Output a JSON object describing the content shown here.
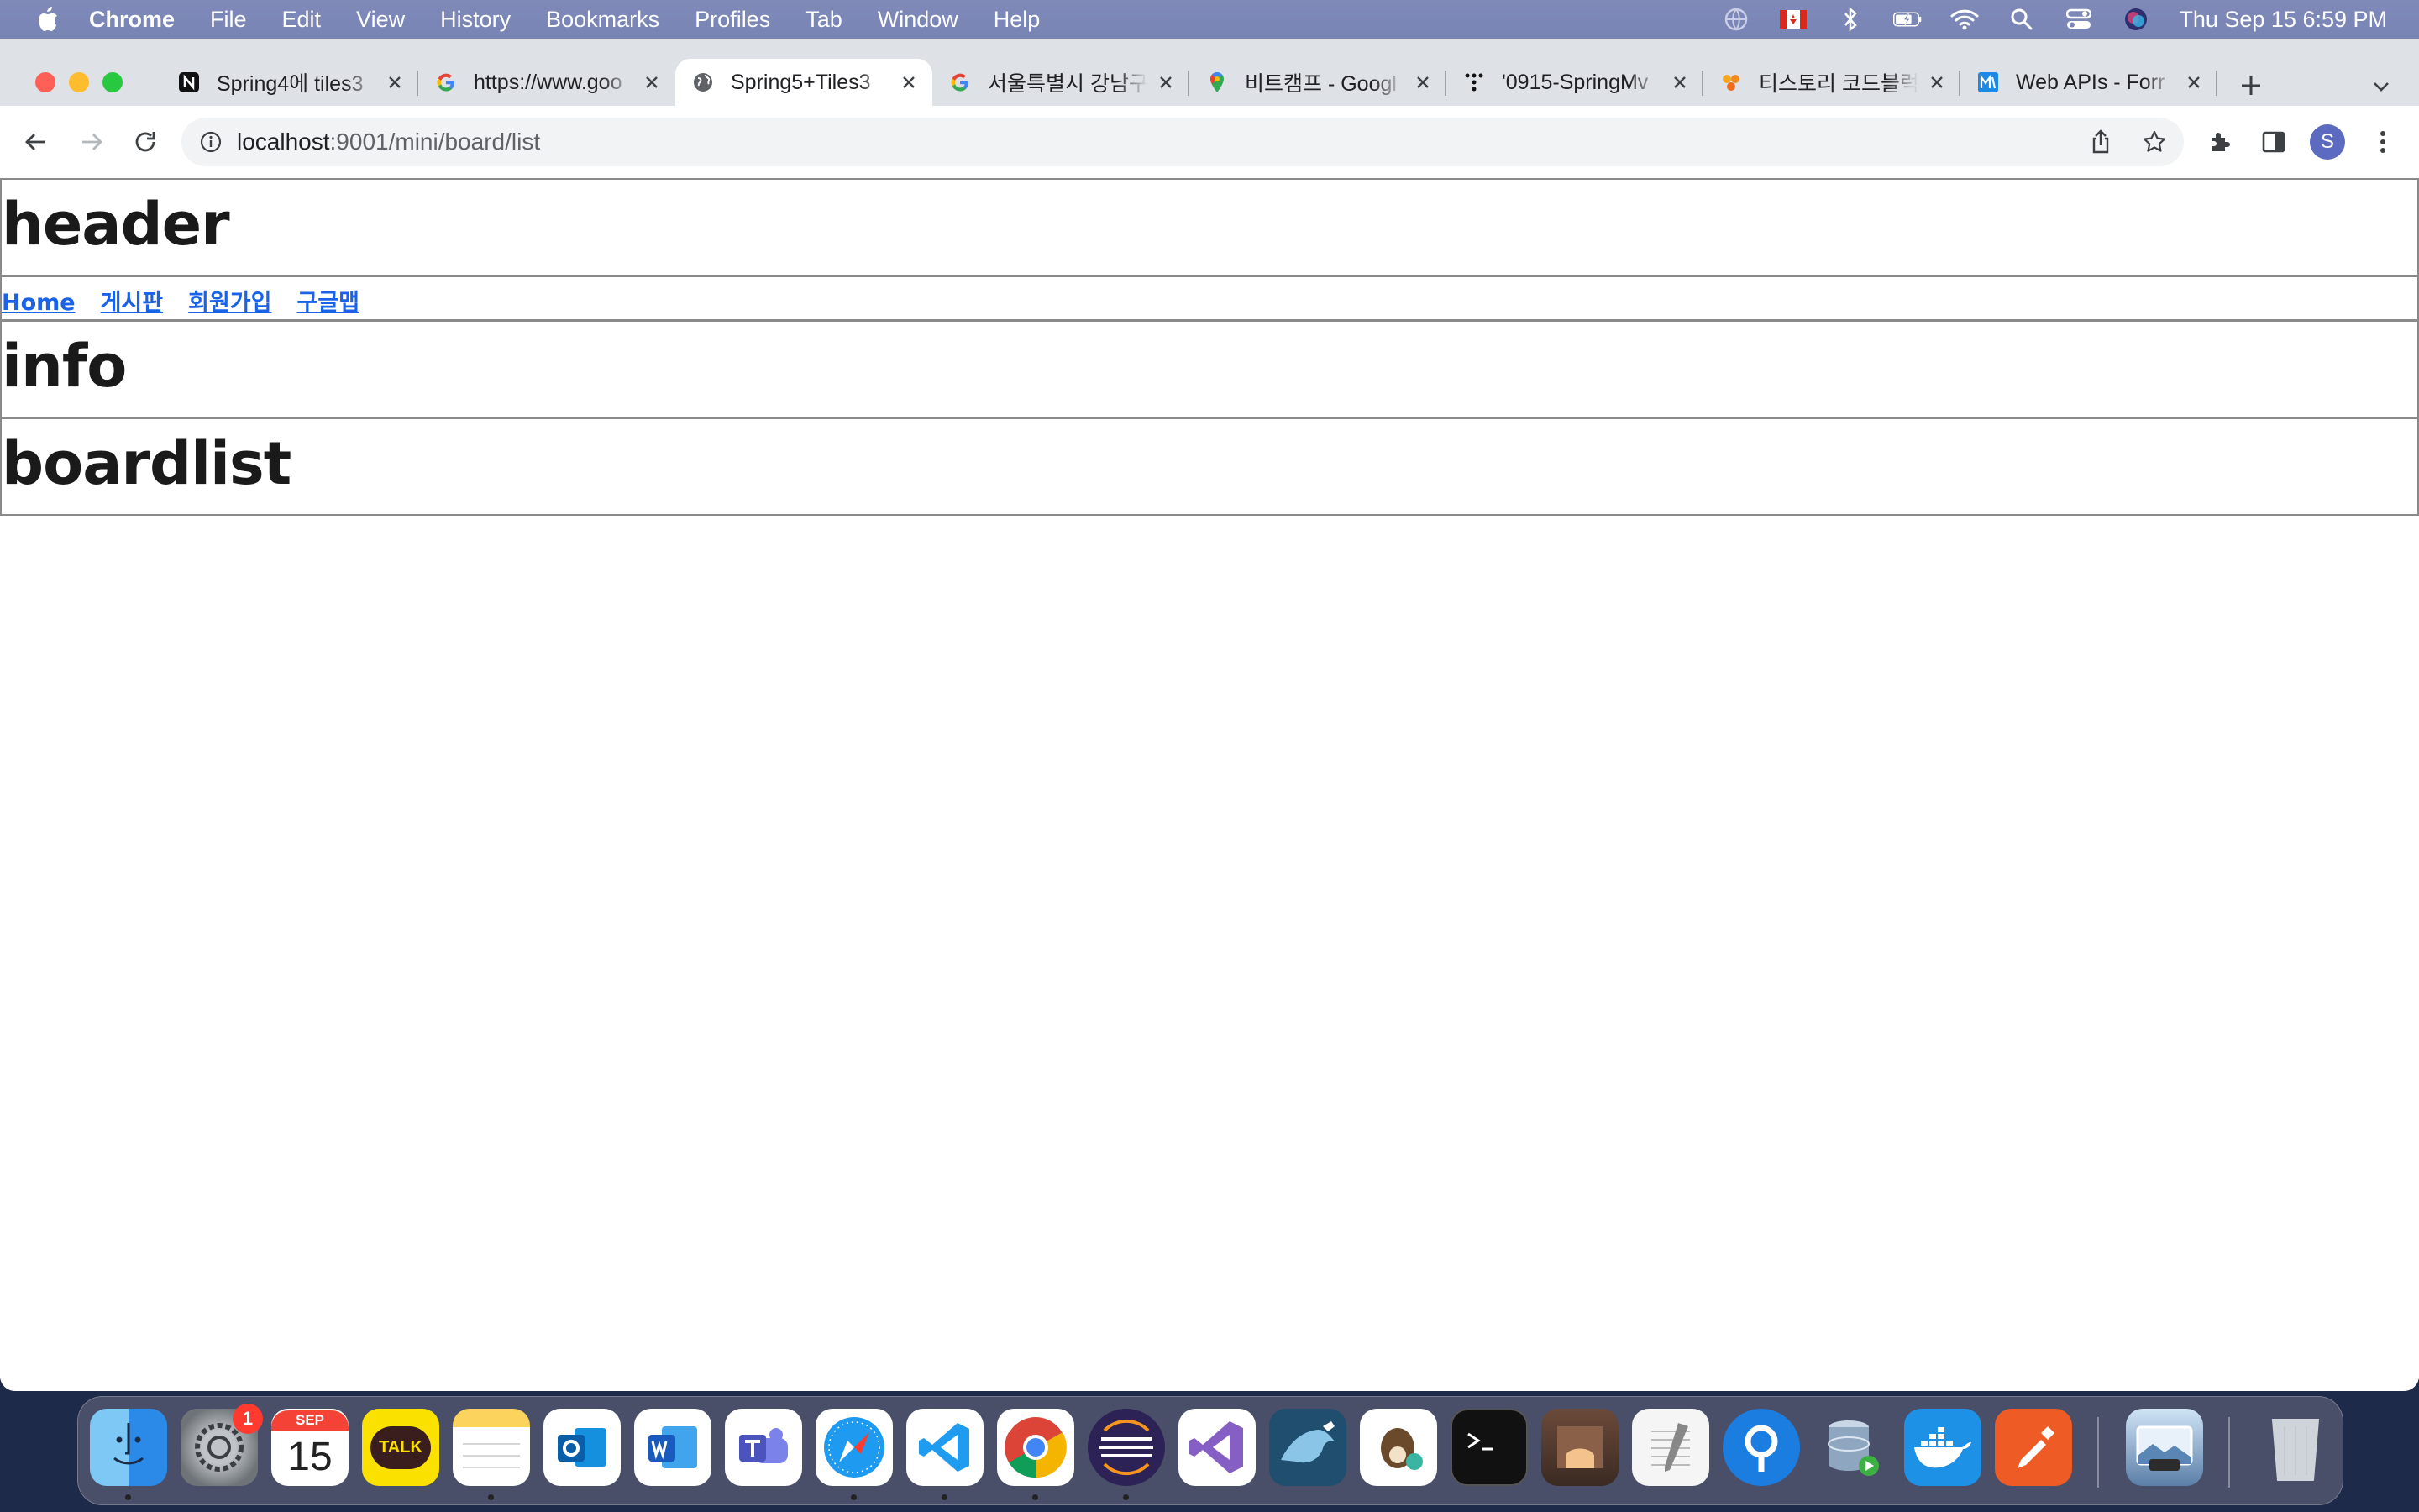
{
  "menubar": {
    "app_name": "Chrome",
    "items": [
      "File",
      "Edit",
      "View",
      "History",
      "Bookmarks",
      "Profiles",
      "Tab",
      "Window",
      "Help"
    ],
    "clock": "Thu Sep 15  6:59 PM"
  },
  "tabs": [
    {
      "title": "Spring4에 tiles3",
      "favicon": "notion-icon",
      "active": false
    },
    {
      "title": "https://www.goo",
      "favicon": "google-icon",
      "active": false
    },
    {
      "title": "Spring5+Tiles3",
      "favicon": "globe-icon",
      "active": true
    },
    {
      "title": "서울특별시 강남구",
      "favicon": "google-icon",
      "active": false
    },
    {
      "title": "비트캠프 - Googl",
      "favicon": "google-maps-icon",
      "active": false
    },
    {
      "title": "'0915-SpringMv",
      "favicon": "dots-icon",
      "active": false
    },
    {
      "title": "티스토리 코드블럭",
      "favicon": "tistory-icon",
      "active": false
    },
    {
      "title": "Web APIs - Forr",
      "favicon": "mdn-icon",
      "active": false
    }
  ],
  "omnibox": {
    "host": "localhost",
    "path": ":9001/mini/board/list"
  },
  "profile_initial": "S",
  "page": {
    "header": "header",
    "nav_links": [
      "Home",
      "게시판",
      "회원가입",
      "구글맵"
    ],
    "info": "info",
    "content": "boardlist"
  },
  "dock": {
    "settings_badge": "1",
    "calendar_month": "SEP",
    "calendar_day": "15",
    "talk_label": "TALK"
  },
  "colors": {
    "link": "#1a62e8",
    "tile_border": "#8a8a8a",
    "menubar": "#7884b4"
  }
}
